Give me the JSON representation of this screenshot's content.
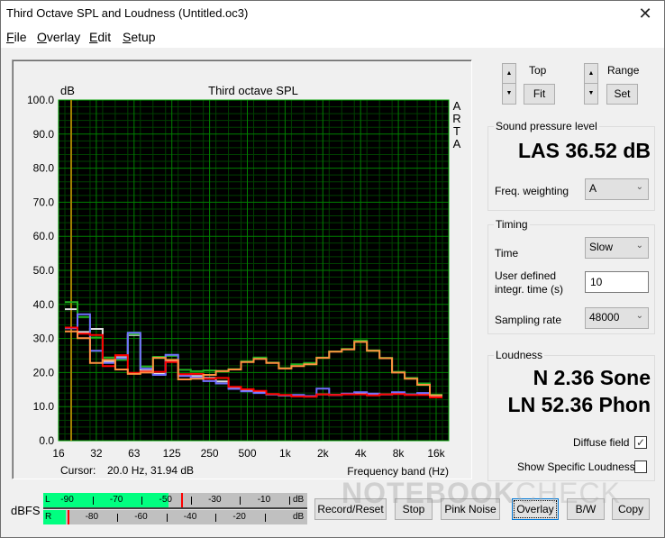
{
  "window": {
    "title": "Third Octave SPL and Loudness (Untitled.oc3)",
    "close_glyph": "✕"
  },
  "menu": [
    {
      "label": "File",
      "accel": "F",
      "rest": "ile"
    },
    {
      "label": "Overlay",
      "accel": "O",
      "rest": "verlay"
    },
    {
      "label": "Edit",
      "accel": "E",
      "rest": "dit"
    },
    {
      "label": "Setup",
      "accel": "S",
      "rest": "etup"
    }
  ],
  "chart": {
    "cursor_label": "Cursor:",
    "cursor_value": "20.0 Hz, 31.94 dB",
    "cursor_freq_index": 0,
    "cursor_color": "#a08000",
    "background": "#000000",
    "grid_major_color": "#008000",
    "grid_minor_color": "#004000",
    "brand_text": [
      "A",
      "R",
      "T",
      "A"
    ]
  },
  "chart_data": {
    "type": "line",
    "title": "Third octave SPL",
    "ylabel": "dB",
    "xlabel": "Frequency band (Hz)",
    "ylim": [
      0,
      100
    ],
    "yticks": [
      "0.0",
      "10.0",
      "20.0",
      "30.0",
      "40.0",
      "50.0",
      "60.0",
      "70.0",
      "80.0",
      "90.0",
      "100.0"
    ],
    "xticks": [
      "16",
      "32",
      "63",
      "125",
      "250",
      "500",
      "1k",
      "2k",
      "4k",
      "8k",
      "16k"
    ],
    "grid": true,
    "style": "step",
    "bands": [
      "20",
      "25",
      "31.5",
      "40",
      "50",
      "63",
      "80",
      "100",
      "125",
      "160",
      "200",
      "250",
      "315",
      "400",
      "500",
      "630",
      "800",
      "1k",
      "1.25k",
      "1.6k",
      "2k",
      "2.5k",
      "3.15k",
      "4k",
      "5k",
      "6.3k",
      "8k",
      "10k",
      "12.5k",
      "16k"
    ],
    "series": [
      {
        "name": "white",
        "color": "#e0e0e0",
        "values": [
          38.6,
          31.9,
          32.8,
          23.3,
          24.5,
          31.0,
          20.6,
          19.6,
          23.4,
          19.3,
          19.0,
          18.4,
          17.4,
          15.5,
          14.8,
          14.3,
          13.6,
          13.3,
          13.2,
          13.0,
          13.6,
          13.4,
          13.7,
          13.9,
          13.5,
          13.6,
          13.9,
          13.5,
          13.7,
          13.2
        ]
      },
      {
        "name": "green",
        "color": "#20b020",
        "values": [
          40.7,
          36.3,
          30.3,
          24.4,
          23.7,
          31.3,
          21.8,
          24.6,
          24.9,
          20.8,
          20.4,
          20.6,
          20.5,
          21.0,
          23.3,
          24.4,
          22.9,
          21.3,
          22.4,
          22.8,
          24.4,
          26.2,
          26.9,
          29.4,
          26.5,
          24.3,
          20.2,
          18.4,
          16.8,
          13.5
        ]
      },
      {
        "name": "blue",
        "color": "#7070ff",
        "values": [
          33.0,
          37.1,
          26.4,
          22.8,
          24.2,
          31.7,
          21.2,
          19.3,
          25.2,
          19.0,
          18.6,
          17.5,
          16.8,
          15.2,
          14.5,
          14.0,
          13.6,
          13.3,
          13.4,
          13.1,
          15.3,
          13.4,
          13.8,
          14.2,
          13.8,
          13.6,
          14.2,
          13.6,
          14.0,
          13.1
        ]
      },
      {
        "name": "red",
        "color": "#ff0000",
        "values": [
          33.2,
          31.4,
          31.0,
          21.9,
          25.1,
          19.9,
          20.3,
          20.2,
          23.1,
          19.5,
          19.6,
          18.2,
          18.4,
          15.8,
          15.1,
          14.6,
          13.7,
          13.4,
          13.0,
          12.9,
          13.6,
          13.4,
          13.6,
          13.6,
          13.3,
          13.6,
          13.7,
          13.4,
          13.4,
          12.7
        ]
      },
      {
        "name": "orange",
        "color": "#ff9040",
        "values": [
          32.1,
          30.1,
          22.8,
          23.7,
          20.9,
          19.6,
          20.0,
          24.3,
          23.7,
          18.0,
          18.2,
          19.3,
          20.4,
          20.9,
          23.1,
          24.0,
          22.8,
          21.2,
          21.9,
          22.4,
          24.3,
          26.1,
          26.8,
          29.0,
          26.4,
          24.2,
          20.0,
          18.2,
          16.4,
          13.3
        ]
      }
    ]
  },
  "controls": {
    "top_label": "Top",
    "fit_button": "Fit",
    "range_label": "Range",
    "set_button": "Set",
    "spin_up": "▲",
    "spin_down": "▼"
  },
  "spl": {
    "group_title": "Sound pressure level",
    "value": "LAS 36.52 dB",
    "weighting_label": "Freq. weighting",
    "weighting_value": "A"
  },
  "timing": {
    "group_title": "Timing",
    "time_label": "Time",
    "time_value": "Slow",
    "user_time_label_1": "User defined",
    "user_time_label_2": "integr. time (s)",
    "user_time_value": "10",
    "sampling_label": "Sampling rate",
    "sampling_value": "48000"
  },
  "loudness": {
    "group_title": "Loudness",
    "sone": "N 2.36 Sone",
    "phon": "LN 52.36 Phon",
    "diffuse_label": "Diffuse field",
    "diffuse_checked": true,
    "specific_label": "Show Specific Loudness",
    "specific_checked": false
  },
  "meter": {
    "label": "dBFS",
    "left": {
      "channel": "L",
      "level_db": -49,
      "peak_db": -44,
      "ticks": [
        "-90",
        "-70",
        "-50",
        "-30",
        "-10"
      ],
      "unit": "dB"
    },
    "right": {
      "channel": "R",
      "level_db": -91,
      "peak_db": -90,
      "ticks": [
        "-80",
        "-60",
        "-40",
        "-20"
      ],
      "unit": "dB"
    },
    "range_db": [
      -100,
      0
    ],
    "fill_color": "#00ff80",
    "peak_color": "#ff0000"
  },
  "buttons": {
    "record_reset": "Record/Reset",
    "stop": "Stop",
    "pink_noise": "Pink Noise",
    "overlay": "Overlay",
    "bw": "B/W",
    "copy": "Copy"
  },
  "watermark": {
    "bold": "NOTEBOOK",
    "light": "CHECK"
  }
}
